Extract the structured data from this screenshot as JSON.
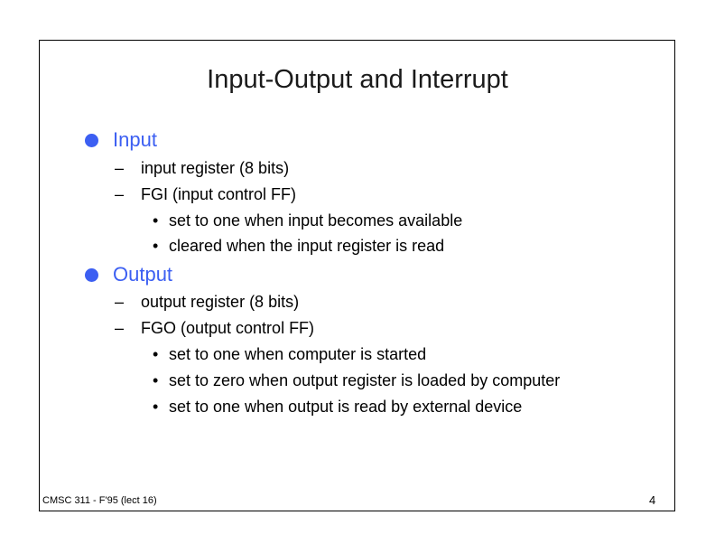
{
  "slide": {
    "title": "Input-Output and Interrupt",
    "sections": [
      {
        "heading": "Input",
        "items": [
          {
            "text": "input register (8 bits)",
            "subitems": []
          },
          {
            "text": "FGI (input control FF)",
            "subitems": [
              "set to one when input becomes available",
              "cleared when the input register is read"
            ]
          }
        ]
      },
      {
        "heading": "Output",
        "items": [
          {
            "text": "output register (8 bits)",
            "subitems": []
          },
          {
            "text": "FGO (output control FF)",
            "subitems": [
              "set to one when computer is started",
              "set to zero when output register is loaded by computer",
              "set to one when output is read by external device"
            ]
          }
        ]
      }
    ],
    "footer": "CMSC 311 - F'95 (lect 16)",
    "page_number": "4",
    "symbols": {
      "dash": "–",
      "bullet": "•"
    }
  },
  "colors": {
    "accent": "#3c5ff2",
    "text": "#000000",
    "title": "#1a1a1a"
  },
  "icons": {
    "section_bullet": "filled-circle"
  }
}
